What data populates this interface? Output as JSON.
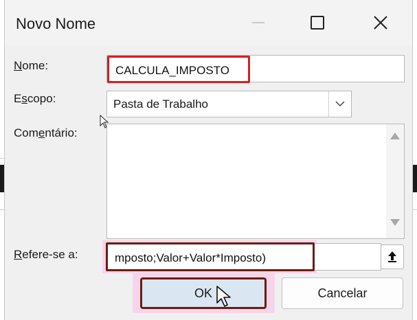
{
  "dialog": {
    "title": "Novo Nome",
    "controls": {
      "minimize": "minimize-icon",
      "maximize": "maximize-icon",
      "close": "close-icon"
    }
  },
  "form": {
    "name_label_mnemonic": "N",
    "name_label_rest": "ome:",
    "name_value": "CALCULA_IMPOSTO",
    "scope_label_pre": "E",
    "scope_label_mnemonic": "s",
    "scope_label_post": "copo:",
    "scope_value": "Pasta de Trabalho",
    "comment_label_pre": "Com",
    "comment_label_mnemonic": "e",
    "comment_label_post": "ntário:",
    "comment_value": "",
    "refers_label_mnemonic": "R",
    "refers_label_rest": "efere-se a:",
    "refers_value": "mposto;Valor+Valor*Imposto)"
  },
  "buttons": {
    "ok": "OK",
    "cancel": "Cancelar"
  },
  "colors": {
    "highlight_red": "#d32020",
    "highlight_dark": "#6b1b12",
    "highlight_pink": "#f6d5ea",
    "ok_fill": "#dbe6f3"
  }
}
